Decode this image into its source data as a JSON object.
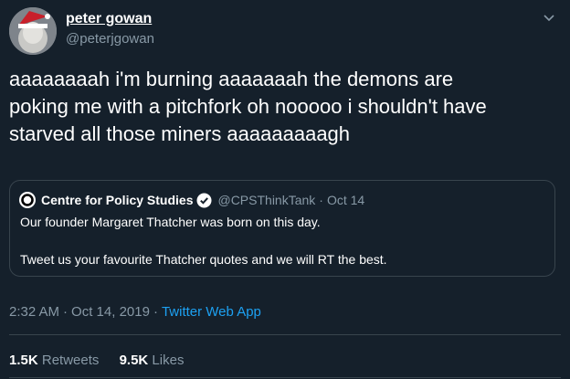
{
  "author": {
    "name": "peter gowan",
    "handle": "@peterjgowan"
  },
  "tweet": {
    "lines": [
      "aaaaaaaah i'm burning aaaaaaah the demons are",
      "poking me with a pitchfork oh nooooo i shouldn't have",
      "starved all those miners aaaaaaaaagh"
    ]
  },
  "quote": {
    "name": "Centre for Policy Studies",
    "handle": "@CPSThinkTank",
    "dot": "·",
    "date": "Oct 14",
    "line1": "Our founder Margaret Thatcher was born on this day.",
    "line2": "Tweet us your favourite Thatcher quotes and we will RT the best."
  },
  "meta": {
    "time": "2:32 AM",
    "sep": "·",
    "date": "Oct 14, 2019",
    "sep2": "·",
    "source": "Twitter Web App"
  },
  "stats": {
    "retweets_count": "1.5K",
    "retweets_label": "Retweets",
    "likes_count": "9.5K",
    "likes_label": "Likes"
  },
  "colors": {
    "background": "#15202b",
    "text": "#ffffff",
    "secondary": "#8899a6",
    "accent": "#1da1f2",
    "border": "#38444d"
  },
  "icons": {
    "more": "chevron-down-icon",
    "verified": "verified-badge-icon",
    "quote_avatar": "cps-logo-icon"
  }
}
